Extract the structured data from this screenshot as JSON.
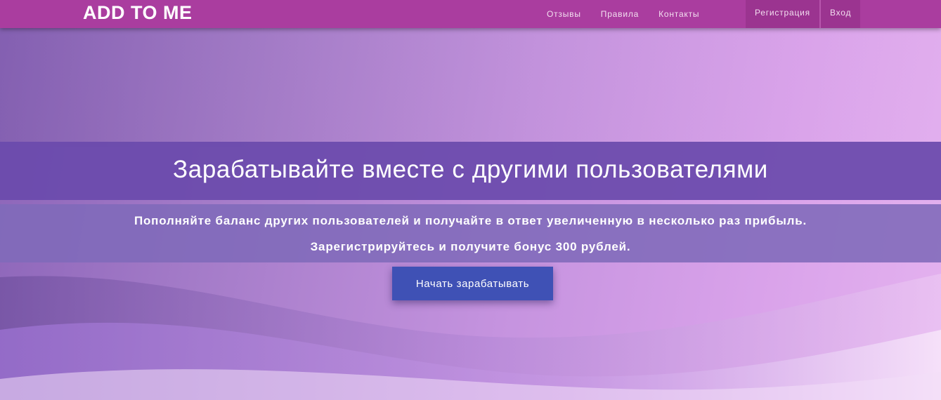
{
  "header": {
    "brand": "ADD TO ME",
    "nav": [
      {
        "label": "Отзывы"
      },
      {
        "label": "Правила"
      },
      {
        "label": "Контакты"
      }
    ],
    "auth": {
      "register_label": "Регистрация",
      "login_label": "Вход"
    }
  },
  "hero": {
    "title": "Зарабатывайте вместе с другими пользователями",
    "subtitle_line1": "Пополняйте баланс других пользователей и получайте в ответ увеличенную в несколько раз прибыль.",
    "subtitle_line2_prefix": "Зарегистрируйтесь и получите бонус ",
    "subtitle_line2_amount": "300 рублей",
    "subtitle_line2_suffix": ".",
    "cta_label": "Начать зарабатывать"
  },
  "colors": {
    "navbar": "#aa3d9f",
    "title_band": "#6a4aac",
    "cta": "#3f51b5"
  }
}
